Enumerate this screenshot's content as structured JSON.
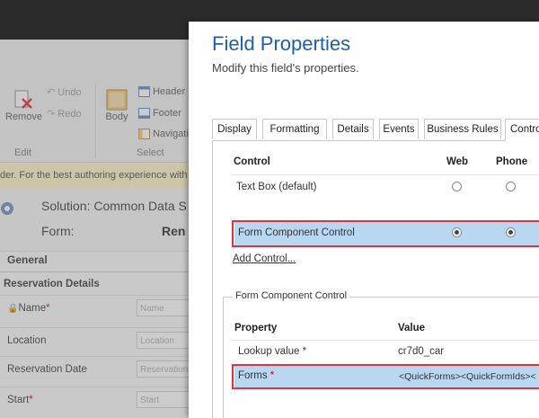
{
  "ribbon": {
    "remove_label": "Remove",
    "undo_label": "Undo",
    "redo_label": "Redo",
    "body_label": "Body",
    "header_label": "Header",
    "footer_label": "Footer",
    "navigation_label": "Navigati",
    "group_edit": "Edit",
    "group_select": "Select"
  },
  "notice": {
    "text": "der. For the best authoring experience with"
  },
  "solution": {
    "label": "Solution: Common Data S",
    "form_label": "Form:",
    "form_value": "Ren"
  },
  "form": {
    "tab_title": "General",
    "section_title": "Reservation Details",
    "fields": [
      {
        "label": "Name",
        "required": "*",
        "placeholder": "Name"
      },
      {
        "label": "Location",
        "required": "",
        "placeholder": "Location"
      },
      {
        "label": "Reservation Date",
        "required": "",
        "placeholder": "Reservation"
      },
      {
        "label": "Start",
        "required": "*",
        "placeholder": "Start"
      }
    ]
  },
  "dialog": {
    "title": "Field Properties",
    "subtitle": "Modify this field's properties.",
    "tabs": [
      "Display",
      "Formatting",
      "Details",
      "Events",
      "Business Rules",
      "Controls"
    ],
    "controls": {
      "col_control": "Control",
      "col_web": "Web",
      "col_phone": "Phone",
      "rows": [
        {
          "name": "Text Box (default)",
          "web": false,
          "phone": false
        },
        {
          "name": "Form Component Control",
          "web": true,
          "phone": true
        }
      ],
      "add_control": "Add Control..."
    },
    "component": {
      "legend": "Form Component Control",
      "col_property": "Property",
      "col_value": "Value",
      "rows": [
        {
          "property": "Lookup value",
          "required": "*",
          "value": "cr7d0_car"
        },
        {
          "property": "Forms",
          "required": "*",
          "value": "<QuickForms><QuickFormIds><"
        }
      ]
    }
  },
  "colors": {
    "accent": "#1f5ea8",
    "highlight": "#b9d7f1",
    "callout": "#e0333d"
  }
}
